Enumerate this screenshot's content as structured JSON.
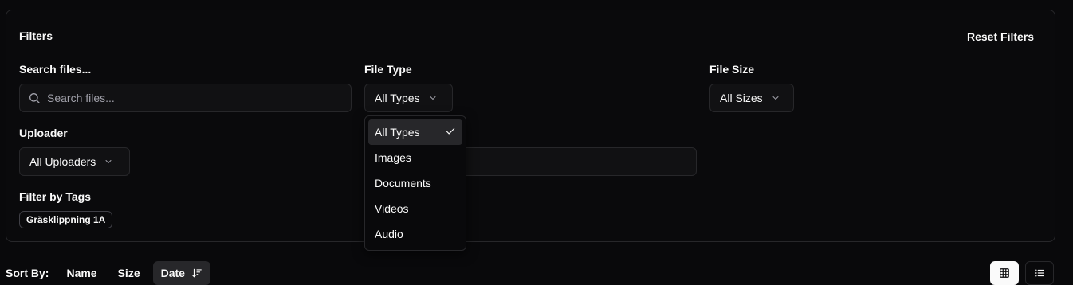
{
  "filters": {
    "title": "Filters",
    "reset_label": "Reset Filters",
    "search": {
      "label": "Search files...",
      "placeholder": "Search files...",
      "value": ""
    },
    "file_type": {
      "label": "File Type",
      "selected": "All Types"
    },
    "file_size": {
      "label": "File Size",
      "selected": "All Sizes"
    },
    "uploader": {
      "label": "Uploader",
      "selected": "All Uploaders"
    },
    "tags": {
      "label": "Filter by Tags",
      "items": [
        "Gräsklippning 1A"
      ]
    }
  },
  "dropdown": {
    "options": [
      "All Types",
      "Images",
      "Documents",
      "Videos",
      "Audio"
    ],
    "selected": "All Types"
  },
  "sort": {
    "label": "Sort By:",
    "options": [
      "Name",
      "Size",
      "Date"
    ],
    "active": "Date"
  },
  "icons": {
    "search": "search-icon",
    "chevron": "chevron-down-icon",
    "check": "check-icon",
    "sort_desc": "sort-descending-icon",
    "grid": "grid-view-icon",
    "list": "list-view-icon"
  }
}
